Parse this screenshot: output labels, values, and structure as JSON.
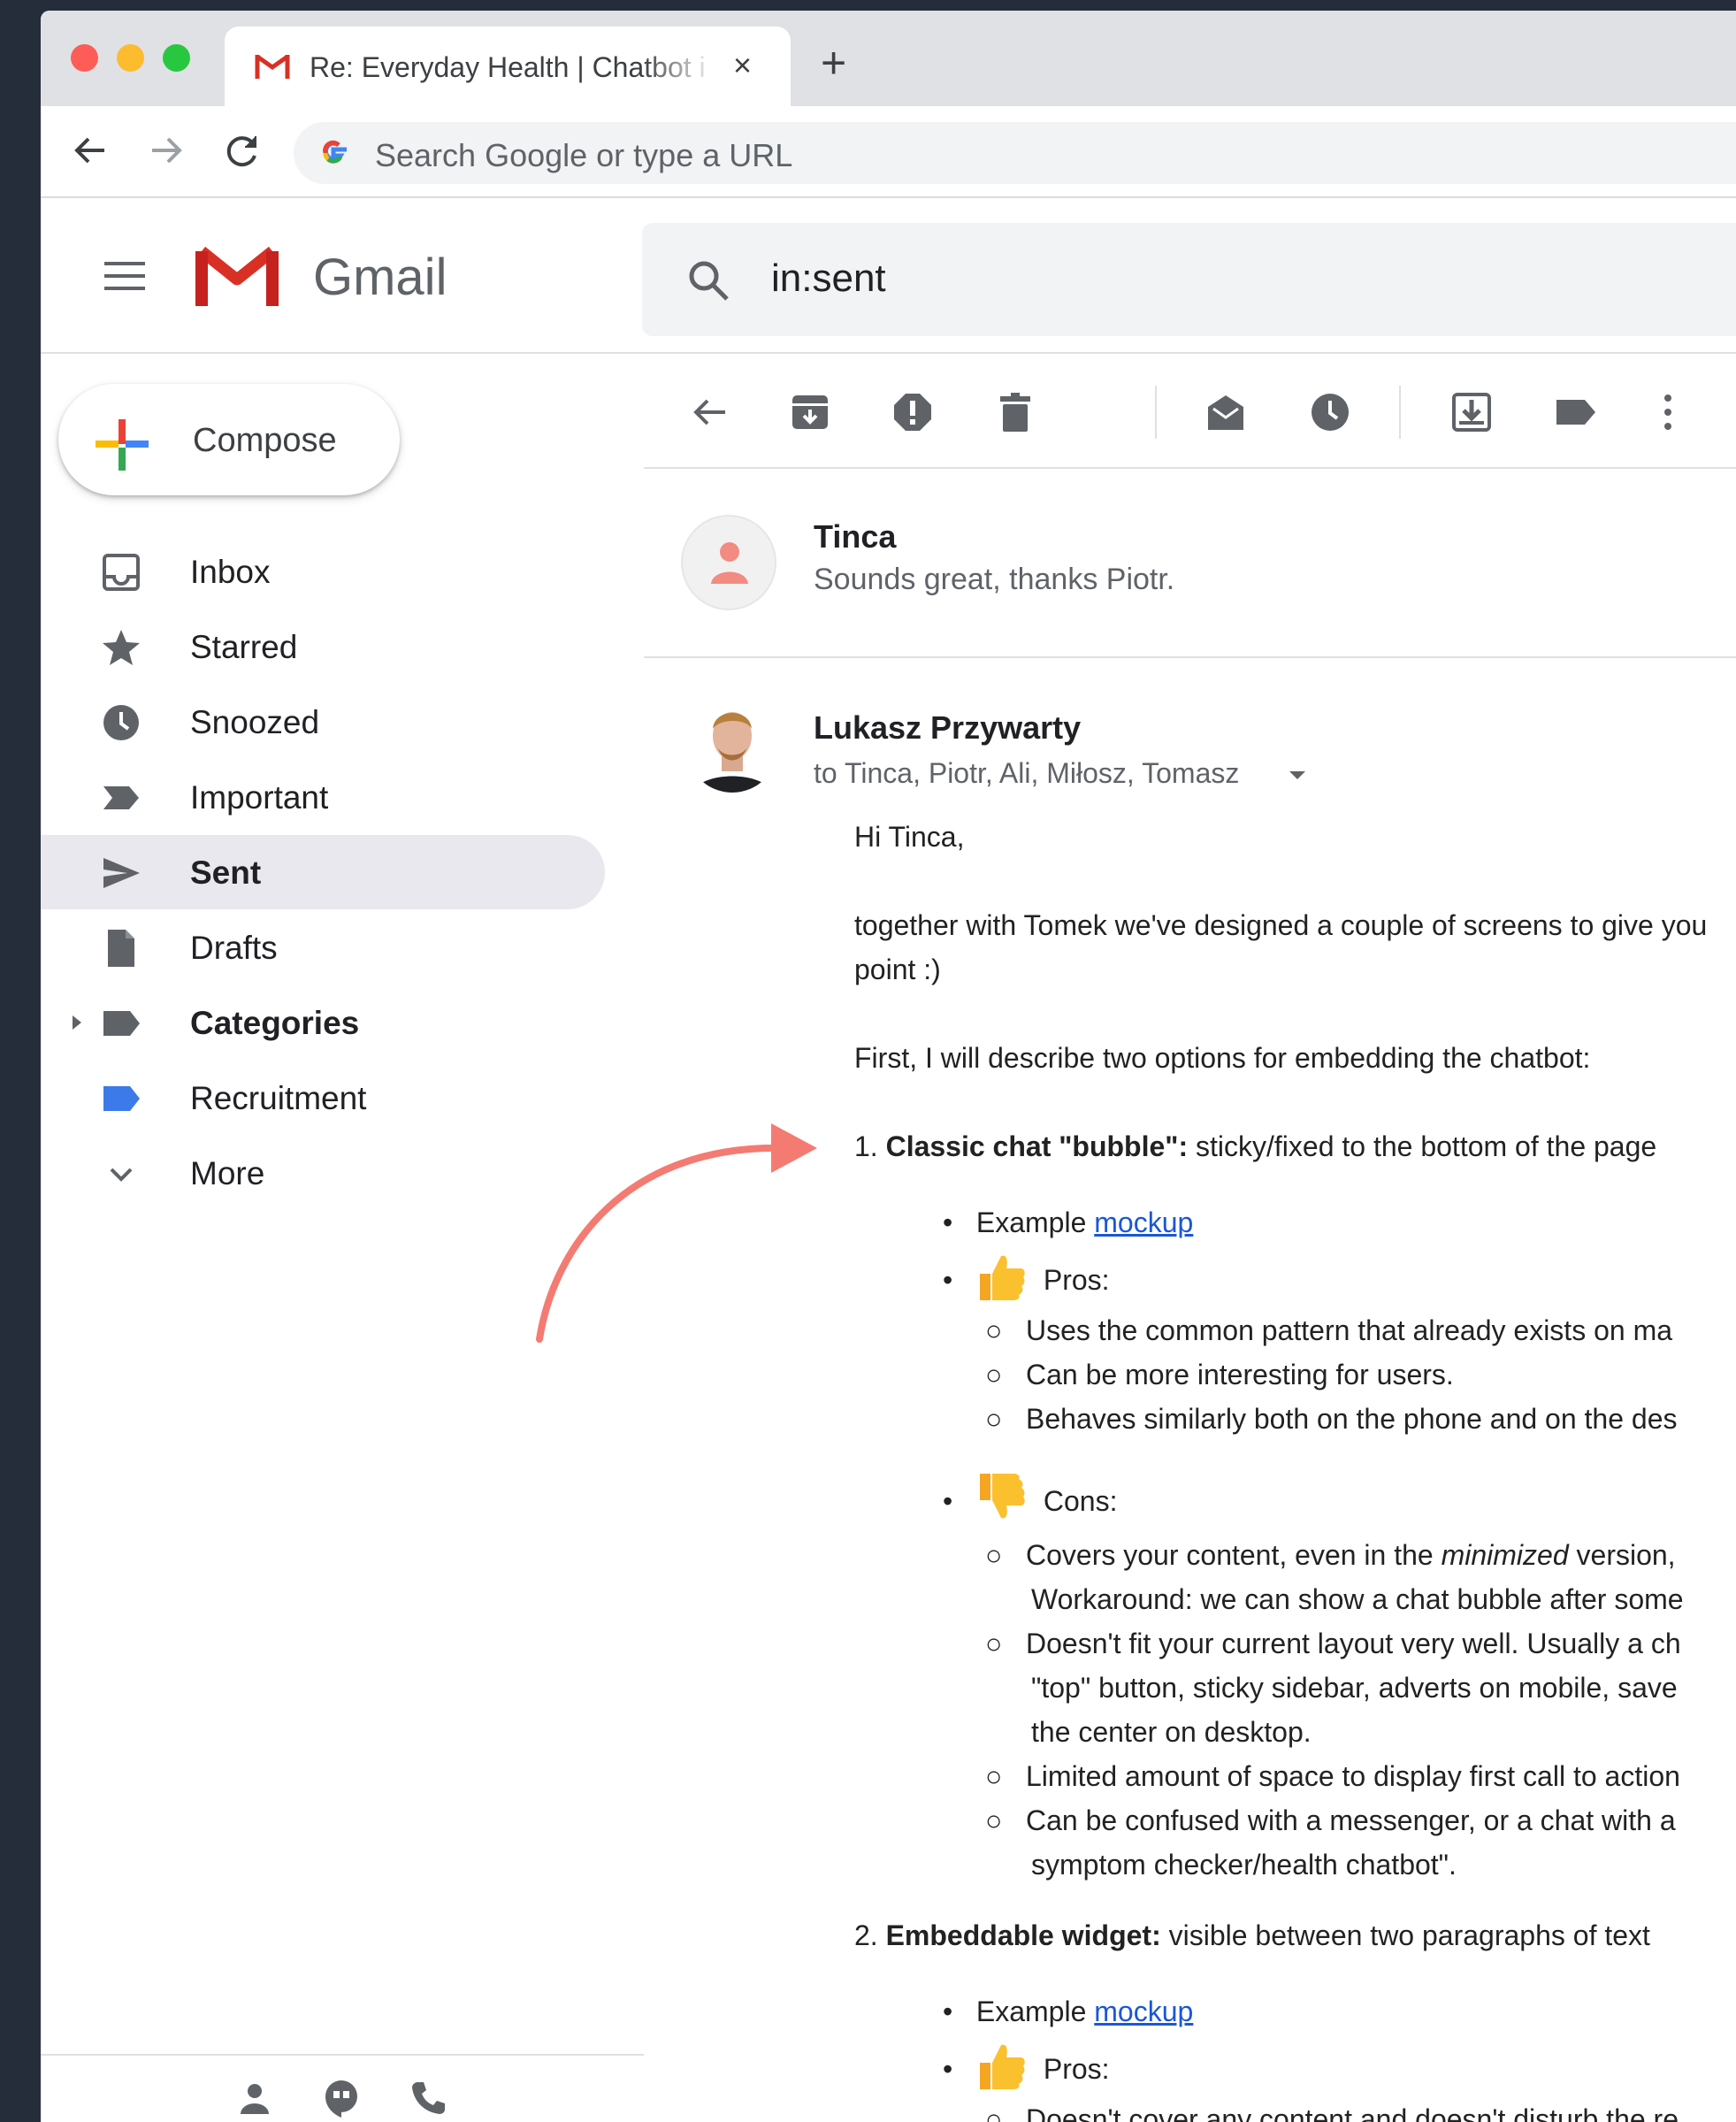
{
  "browser": {
    "tab_title": "Re: Everyday Health | Chatbot i",
    "tab_close": "×",
    "new_tab": "+",
    "address_placeholder": "Search Google or type a URL"
  },
  "gmail": {
    "brand": "Gmail",
    "search_value": "in:sent",
    "compose_label": "Compose",
    "nav": [
      {
        "label": "Inbox",
        "icon": "inbox-icon"
      },
      {
        "label": "Starred",
        "icon": "star-icon"
      },
      {
        "label": "Snoozed",
        "icon": "clock-icon"
      },
      {
        "label": "Important",
        "icon": "important-icon"
      },
      {
        "label": "Sent",
        "icon": "send-icon",
        "active": true
      },
      {
        "label": "Drafts",
        "icon": "draft-icon"
      },
      {
        "label": "Categories",
        "icon": "label-icon"
      },
      {
        "label": "Recruitment",
        "icon": "label-icon",
        "color": "#3b7ae8"
      },
      {
        "label": "More",
        "icon": "chevron-down-icon"
      }
    ]
  },
  "thread": {
    "msg1": {
      "sender": "Tinca",
      "snippet": "Sounds great, thanks Piotr."
    },
    "msg2": {
      "sender": "Lukasz Przywarty",
      "to": "to Tinca, Piotr, Ali, Miłosz, Tomasz",
      "greeting": "Hi Tinca,",
      "intro_1": "together with Tomek we've designed a couple of screens to give you",
      "intro_2": "point :)",
      "lead": "First, I will describe two options for embedding the chatbot:",
      "opt1_num": "1. ",
      "opt1_title": "Classic chat \"bubble\":",
      "opt1_desc": " sticky/fixed to the bottom of the page",
      "example_label": "Example ",
      "mockup_link": "mockup",
      "pros_label": "Pros:",
      "cons_label": "Cons:",
      "pro1": "Uses the common pattern that already exists on ma",
      "pro2": "Can be more interesting for users.",
      "pro3": "Behaves similarly both on the phone and on the des",
      "con1_a": "Covers your content, even in the ",
      "con1_b": "minimized",
      "con1_c": " version,",
      "con1_line2": "Workaround: we can show a chat bubble after some",
      "con2": "Doesn't fit your current layout very well. Usually a ch",
      "con2_line2": "\"top\" button, sticky sidebar, adverts on mobile, save",
      "con2_line3": "the center on desktop.",
      "con3": "Limited amount of space to display first call to action",
      "con4": "Can be confused with a messenger, or a chat with a",
      "con4_line2": "symptom checker/health chatbot\".",
      "opt2_num": "2. ",
      "opt2_title": "Embeddable widget:",
      "opt2_desc": " visible between two paragraphs of text",
      "pro2_1": "Doesn't cover any content and doesn't disturb the re"
    }
  },
  "colors": {
    "gmail_red": "#d93025",
    "link": "#1a57d6",
    "active_nav_bg": "#e8e8ee",
    "arrow": "#f47b72"
  }
}
